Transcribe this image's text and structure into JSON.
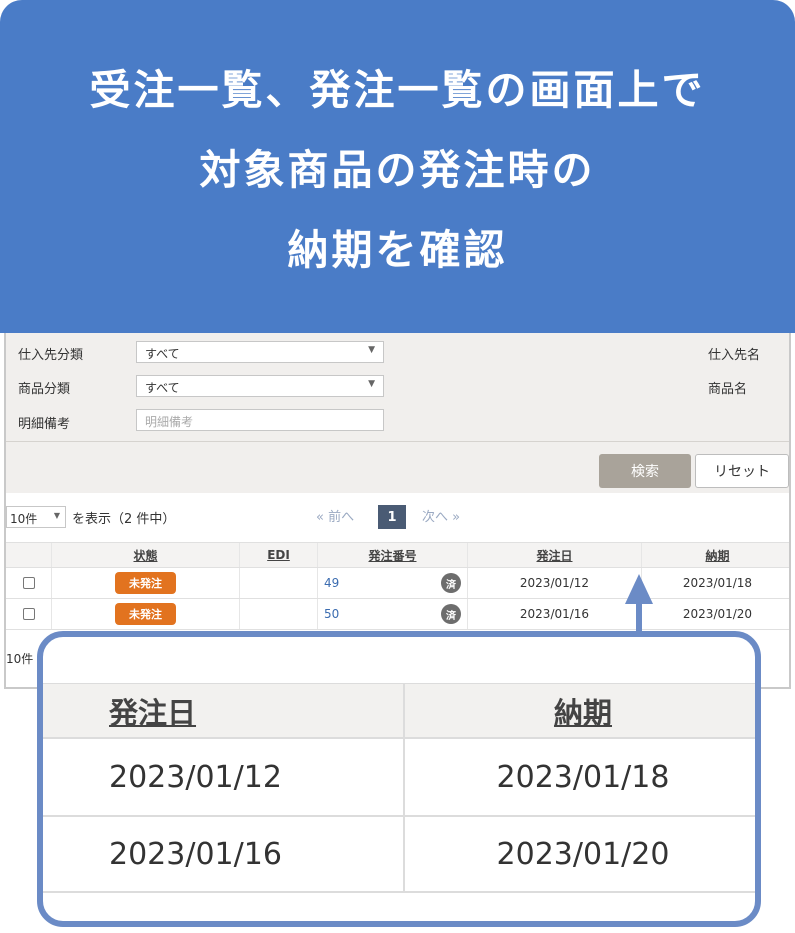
{
  "banner": {
    "line1": "受注一覧、発注一覧の画面上で",
    "line2": "対象商品の発注時の",
    "line3": "納期を確認"
  },
  "filters": {
    "supplier_category_label": "仕入先分類",
    "supplier_category_value": "すべて",
    "product_category_label": "商品分類",
    "product_category_value": "すべて",
    "detail_note_label": "明細備考",
    "detail_note_placeholder": "明細備考",
    "supplier_name_label": "仕入先名",
    "product_name_label": "商品名",
    "search_label": "検索",
    "reset_label": "リセット"
  },
  "pagination": {
    "page_size": "10件",
    "count_text": "を表示（2 件中）",
    "prev_label": "« 前へ",
    "current_page": "1",
    "next_label": "次へ »",
    "bottom_page_size": "10件"
  },
  "table": {
    "headers": {
      "status": "状態",
      "edi": "EDI",
      "order_no": "発注番号",
      "order_date": "発注日",
      "delivery_date": "納期"
    },
    "rows": [
      {
        "status": "未発注",
        "edi": "",
        "order_no": "49",
        "done": "済",
        "order_date": "2023/01/12",
        "delivery_date": "2023/01/18"
      },
      {
        "status": "未発注",
        "edi": "",
        "order_no": "50",
        "done": "済",
        "order_date": "2023/01/16",
        "delivery_date": "2023/01/20"
      }
    ]
  },
  "zoom": {
    "header_order_date": "発注日",
    "header_delivery_date": "納期",
    "rows": [
      {
        "order_date": "2023/01/12",
        "delivery_date": "2023/01/18"
      },
      {
        "order_date": "2023/01/16",
        "delivery_date": "2023/01/20"
      }
    ]
  },
  "colors": {
    "banner_bg": "#4a7cc7",
    "status_badge": "#e2731f",
    "zoom_border": "#6b8bc6"
  }
}
